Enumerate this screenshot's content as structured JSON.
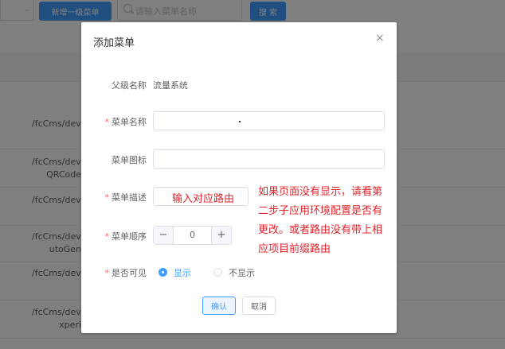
{
  "toolbar": {
    "add_top_menu_label": "新增一级菜单",
    "search_placeholder": "请输入菜单名称",
    "search_button_label": "搜 索"
  },
  "table": {
    "rows": [
      {
        "path": "/fcCms/dev.fc"
      },
      {
        "path": "/fcCms/dev.fc",
        "path2": "QRCode"
      },
      {
        "path": "/fcCms/dev.fc"
      },
      {
        "path": "/fcCms/dev.fc",
        "path2": "utoGen"
      },
      {
        "path": "/fcCms/dev.fc"
      },
      {
        "path": "/fcCms/dev.fc",
        "path2": "xperi"
      }
    ]
  },
  "dialog": {
    "title": "添加菜单",
    "close_icon": "×",
    "parent_label": "父级名称",
    "parent_value": "流量系统",
    "name_label": "菜单名称",
    "name_value": "",
    "icon_label": "菜单图标",
    "icon_value": "",
    "desc_label": "菜单描述",
    "desc_value": "",
    "order_label": "菜单顺序",
    "order_value": "0",
    "minus_symbol": "−",
    "plus_symbol": "+",
    "visible_label": "是否可见",
    "visible_options": [
      "显示",
      "不显示"
    ],
    "visible_selected": "显示",
    "confirm_label": "确认",
    "cancel_label": "取消",
    "required_mark": "*"
  },
  "annotations": {
    "route_hint": "输入对应路由",
    "note_lines": [
      "如果页面没有显示，请看第",
      "二步子应用环境配置是否有",
      "更改。或者路由没有带上相",
      "应项目前缀路由"
    ]
  },
  "colors": {
    "primary": "#409eff",
    "annotation": "#e0242c",
    "required": "#f56c6c"
  }
}
